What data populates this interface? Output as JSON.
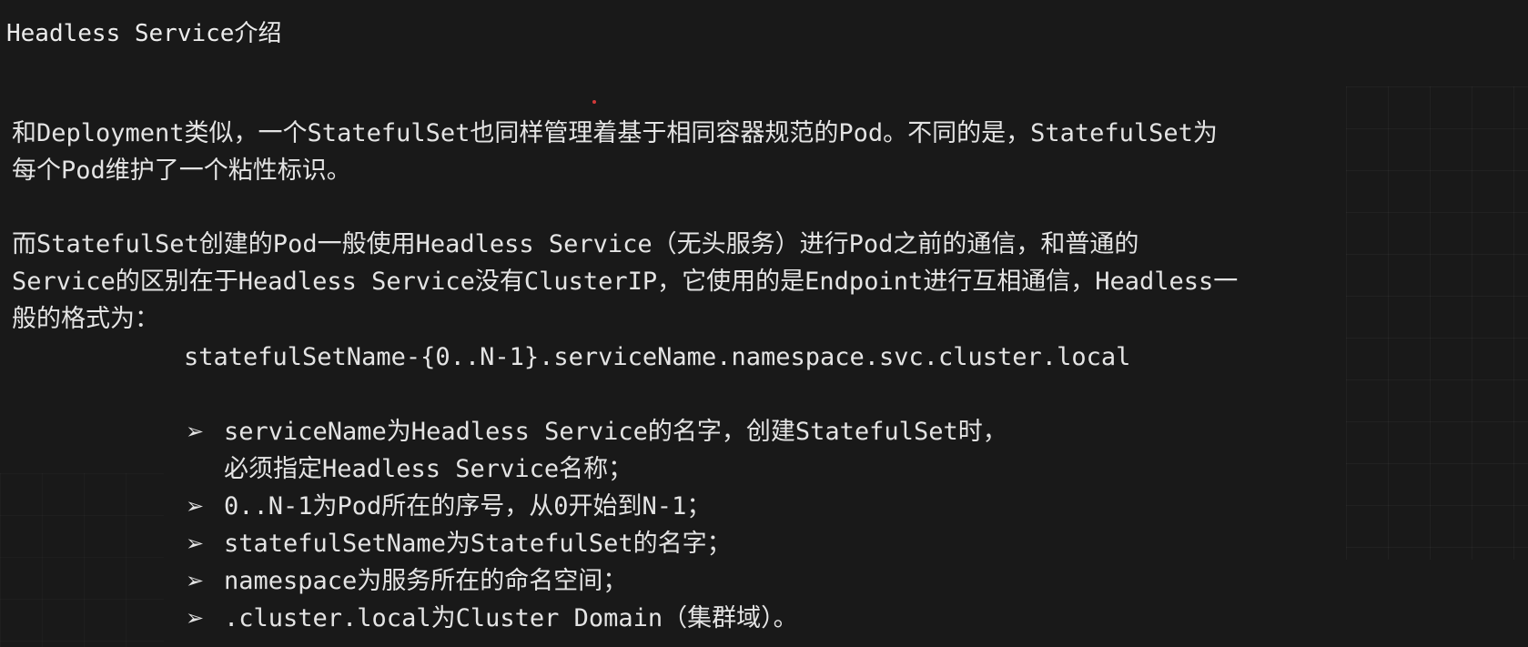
{
  "title": "Headless Service介绍",
  "paragraph1": [
    "和Deployment类似，一个StatefulSet也同样管理着基于相同容器规范的Pod。不同的是，StatefulSet为",
    "每个Pod维护了一个粘性标识。"
  ],
  "paragraph2": [
    "而StatefulSet创建的Pod一般使用Headless Service（无头服务）进行Pod之前的通信，和普通的",
    "Service的区别在于Headless Service没有ClusterIP，它使用的是Endpoint进行互相通信，Headless一",
    "般的格式为："
  ],
  "format_line": "statefulSetName-{0..N-1}.serviceName.namespace.svc.cluster.local",
  "bullet_icon": "arrow-bullet-icon",
  "bullets": [
    {
      "line1": "serviceName为Headless Service的名字，创建StatefulSet时，",
      "line2": "必须指定Headless Service名称；"
    },
    {
      "line1": "0..N-1为Pod所在的序号，从0开始到N-1；"
    },
    {
      "line1": "statefulSetName为StatefulSet的名字；"
    },
    {
      "line1": "namespace为服务所在的命名空间；"
    },
    {
      "line1": ".cluster.local为Cluster Domain（集群域）。"
    }
  ],
  "colors": {
    "background": "#191919",
    "text": "#e4e4e4",
    "dot": "#d23a3a"
  }
}
